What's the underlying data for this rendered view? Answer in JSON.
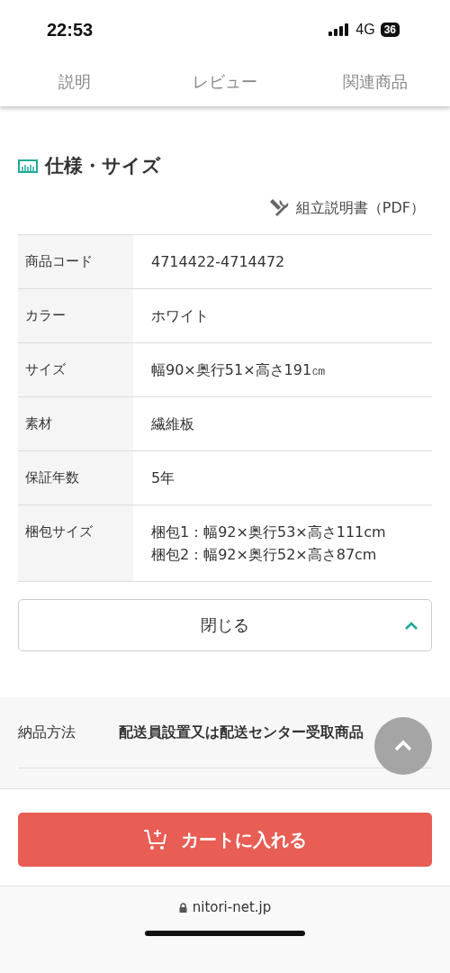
{
  "status_bar": {
    "time": "22:53",
    "network": "4G",
    "battery": "36"
  },
  "tabs": [
    {
      "label": "説明",
      "selected": false
    },
    {
      "label": "レビュー",
      "selected": false
    },
    {
      "label": "関連商品",
      "selected": false
    }
  ],
  "section": {
    "title": "仕様・サイズ",
    "manual_link": "組立説明書（PDF）"
  },
  "specs": [
    {
      "label": "商品コード",
      "value": "4714422-4714472"
    },
    {
      "label": "カラー",
      "value": "ホワイト"
    },
    {
      "label": "サイズ",
      "value": "幅90×奥行51×高さ191㎝"
    },
    {
      "label": "素材",
      "value": "繊維板"
    },
    {
      "label": "保証年数",
      "value": "5年"
    },
    {
      "label": "梱包サイズ",
      "value": "梱包1：幅92×奥行53×高さ111cm　梱包2：幅92×奥行52×高さ87cm"
    }
  ],
  "close_button": "閉じる",
  "delivery": [
    {
      "label": "納品方法",
      "value": "配送員設置又は配送センター受取商品"
    }
  ],
  "cart_button": "カートに入れる",
  "url": "nitori-net.jp"
}
